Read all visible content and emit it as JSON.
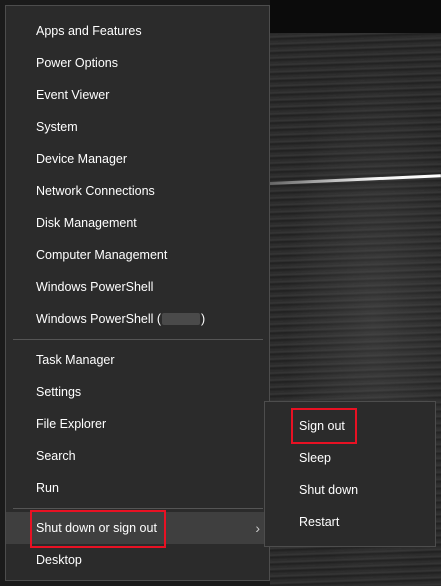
{
  "menu": {
    "items": [
      {
        "label": "Apps and Features"
      },
      {
        "label": "Power Options"
      },
      {
        "label": "Event Viewer"
      },
      {
        "label": "System"
      },
      {
        "label": "Device Manager"
      },
      {
        "label": "Network Connections"
      },
      {
        "label": "Disk Management"
      },
      {
        "label": "Computer Management"
      },
      {
        "label": "Windows PowerShell"
      },
      {
        "label_prefix": "Windows PowerShell (",
        "label_suffix": ")"
      },
      {
        "label": "Task Manager"
      },
      {
        "label": "Settings"
      },
      {
        "label": "File Explorer"
      },
      {
        "label": "Search"
      },
      {
        "label": "Run"
      },
      {
        "label": "Shut down or sign out",
        "chevron": "›"
      },
      {
        "label": "Desktop"
      }
    ]
  },
  "submenu": {
    "items": [
      {
        "label": "Sign out"
      },
      {
        "label": "Sleep"
      },
      {
        "label": "Shut down"
      },
      {
        "label": "Restart"
      }
    ]
  },
  "colors": {
    "menu_bg": "#2b2b2b",
    "highlight_bg": "#3f3f3f",
    "annotation_red": "#e81123"
  }
}
